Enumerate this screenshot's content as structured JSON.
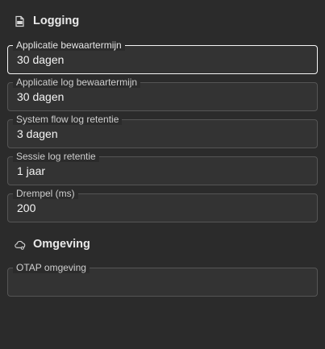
{
  "logging": {
    "title": "Logging",
    "icon": "log-file-icon",
    "fields": [
      {
        "label": "Applicatie bewaartermijn",
        "value": "30 dagen"
      },
      {
        "label": "Applicatie log bewaartermijn",
        "value": "30 dagen"
      },
      {
        "label": "System flow log retentie",
        "value": "3 dagen"
      },
      {
        "label": "Sessie log retentie",
        "value": "1 jaar"
      },
      {
        "label": "Drempel (ms)",
        "value": "200"
      }
    ]
  },
  "environment": {
    "title": "Omgeving",
    "icon": "cloud-settings-icon",
    "fields": [
      {
        "label": "OTAP omgeving",
        "value": ""
      }
    ]
  },
  "colors": {
    "background": "#2b2b2b",
    "field_background": "#333333",
    "field_border": "#555555",
    "focus_border": "#f5f5f5"
  }
}
